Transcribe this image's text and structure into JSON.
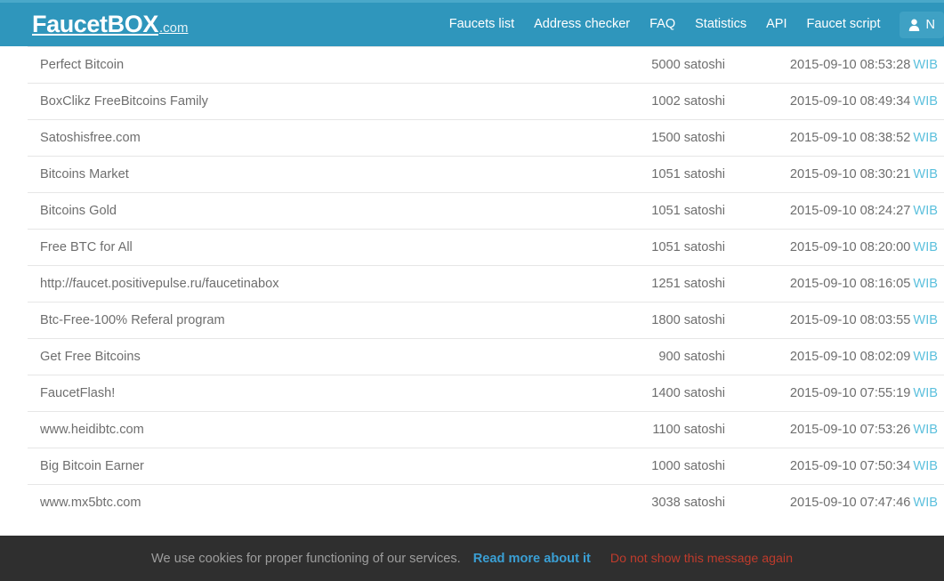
{
  "header": {
    "brand_main": "FaucetBOX",
    "brand_suffix": ".com",
    "nav": [
      {
        "label": "Faucets list",
        "name": "nav-faucets-list"
      },
      {
        "label": "Address checker",
        "name": "nav-address-checker"
      },
      {
        "label": "FAQ",
        "name": "nav-faq"
      },
      {
        "label": "Statistics",
        "name": "nav-statistics"
      },
      {
        "label": "API",
        "name": "nav-api"
      },
      {
        "label": "Faucet script",
        "name": "nav-faucet-script"
      }
    ],
    "account_label": "N",
    "account_icon": "person-icon"
  },
  "table": {
    "rows": [
      {
        "name": "Perfect Bitcoin",
        "amount": "5000 satoshi",
        "date": "2015-09-10 08:53:28",
        "tz": "WIB"
      },
      {
        "name": "BoxClikz FreeBitcoins Family",
        "amount": "1002 satoshi",
        "date": "2015-09-10 08:49:34",
        "tz": "WIB"
      },
      {
        "name": "Satoshisfree.com",
        "amount": "1500 satoshi",
        "date": "2015-09-10 08:38:52",
        "tz": "WIB"
      },
      {
        "name": "Bitcoins Market",
        "amount": "1051 satoshi",
        "date": "2015-09-10 08:30:21",
        "tz": "WIB"
      },
      {
        "name": "Bitcoins Gold",
        "amount": "1051 satoshi",
        "date": "2015-09-10 08:24:27",
        "tz": "WIB"
      },
      {
        "name": "Free BTC for All",
        "amount": "1051 satoshi",
        "date": "2015-09-10 08:20:00",
        "tz": "WIB"
      },
      {
        "name": "http://faucet.positivepulse.ru/faucetinabox",
        "amount": "1251 satoshi",
        "date": "2015-09-10 08:16:05",
        "tz": "WIB"
      },
      {
        "name": "Btc-Free-100% Referal program",
        "amount": "1800 satoshi",
        "date": "2015-09-10 08:03:55",
        "tz": "WIB"
      },
      {
        "name": "Get Free Bitcoins",
        "amount": "900 satoshi",
        "date": "2015-09-10 08:02:09",
        "tz": "WIB"
      },
      {
        "name": "FaucetFlash!",
        "amount": "1400 satoshi",
        "date": "2015-09-10 07:55:19",
        "tz": "WIB"
      },
      {
        "name": "www.heidibtc.com",
        "amount": "1100 satoshi",
        "date": "2015-09-10 07:53:26",
        "tz": "WIB"
      },
      {
        "name": "Big Bitcoin Earner",
        "amount": "1000 satoshi",
        "date": "2015-09-10 07:50:34",
        "tz": "WIB"
      },
      {
        "name": "www.mx5btc.com",
        "amount": "3038 satoshi",
        "date": "2015-09-10 07:47:46",
        "tz": "WIB"
      }
    ]
  },
  "cookie_bar": {
    "message": "We use cookies for proper functioning of our services.",
    "read_more": "Read more about it",
    "dismiss": "Do not show this message again"
  },
  "colors": {
    "navbar": "#2f96bc",
    "top_strip": "#4aa8c9",
    "link_teal": "#5cc0dd",
    "cookie_bg": "#2f2f2f",
    "cookie_link": "#3a9fd4",
    "cookie_dismiss": "#bf3b2c"
  }
}
